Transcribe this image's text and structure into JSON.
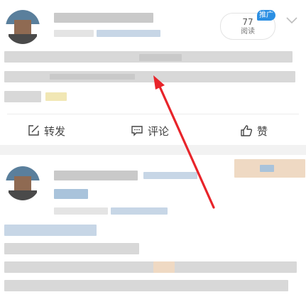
{
  "post1": {
    "read_count": "77",
    "read_label": "阅读",
    "promo_badge": "推广",
    "actions": {
      "repost_label": "转发",
      "comment_label": "评论",
      "like_label": "赞"
    }
  },
  "icons": {
    "repost": "edit-share-icon",
    "comment": "comment-bubble-icon",
    "like": "thumbs-up-icon",
    "menu": "chevron-down-icon"
  },
  "colors": {
    "annotation_arrow": "#e8242a",
    "promo_badge": "#2b8fe3"
  }
}
